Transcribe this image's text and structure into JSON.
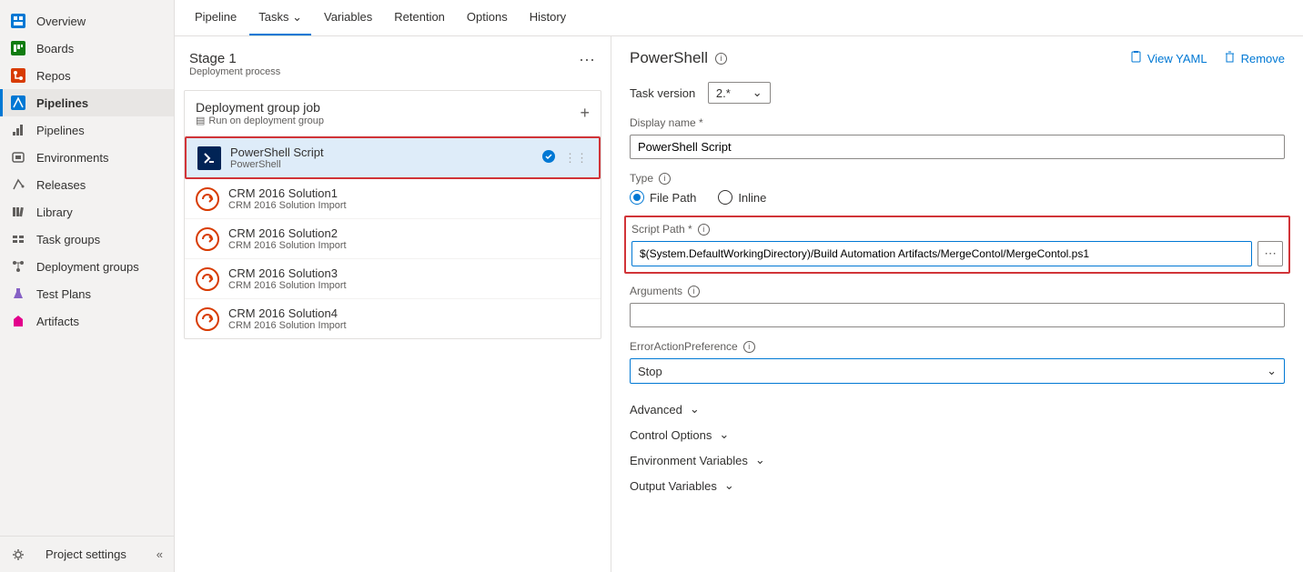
{
  "sidebar": {
    "items": [
      {
        "label": "Overview",
        "icon": "overview"
      },
      {
        "label": "Boards",
        "icon": "boards"
      },
      {
        "label": "Repos",
        "icon": "repos"
      },
      {
        "label": "Pipelines",
        "icon": "pipelines",
        "active": true
      },
      {
        "label": "Pipelines",
        "icon": "pipelines-sub",
        "sub": true
      },
      {
        "label": "Environments",
        "icon": "environments",
        "sub": true
      },
      {
        "label": "Releases",
        "icon": "releases",
        "sub": true
      },
      {
        "label": "Library",
        "icon": "library",
        "sub": true
      },
      {
        "label": "Task groups",
        "icon": "taskgroups",
        "sub": true
      },
      {
        "label": "Deployment groups",
        "icon": "deploymentgroups",
        "sub": true
      },
      {
        "label": "Test Plans",
        "icon": "testplans"
      },
      {
        "label": "Artifacts",
        "icon": "artifacts"
      }
    ],
    "footer": {
      "label": "Project settings"
    }
  },
  "tabs": [
    {
      "label": "Pipeline"
    },
    {
      "label": "Tasks",
      "active": true,
      "dropdown": true
    },
    {
      "label": "Variables"
    },
    {
      "label": "Retention"
    },
    {
      "label": "Options"
    },
    {
      "label": "History"
    }
  ],
  "stage": {
    "title": "Stage 1",
    "subtitle": "Deployment process",
    "job": {
      "title": "Deployment group job",
      "subtitle": "Run on deployment group"
    },
    "tasks": [
      {
        "title": "PowerShell Script",
        "sub": "PowerShell",
        "icon": "ps",
        "selected": true,
        "badge": true
      },
      {
        "title": "CRM 2016 Solution1",
        "sub": "CRM 2016 Solution Import",
        "icon": "crm"
      },
      {
        "title": "CRM 2016 Solution2",
        "sub": "CRM 2016 Solution Import",
        "icon": "crm"
      },
      {
        "title": "CRM 2016 Solution3",
        "sub": "CRM 2016 Solution Import",
        "icon": "crm"
      },
      {
        "title": "CRM 2016 Solution4",
        "sub": "CRM 2016 Solution Import",
        "icon": "crm"
      }
    ]
  },
  "details": {
    "title": "PowerShell",
    "actions": {
      "yaml": "View YAML",
      "remove": "Remove"
    },
    "task_version": {
      "label": "Task version",
      "value": "2.*"
    },
    "display_name": {
      "label": "Display name *",
      "value": "PowerShell Script"
    },
    "type": {
      "label": "Type",
      "options": [
        "File Path",
        "Inline"
      ],
      "selected": "File Path"
    },
    "script_path": {
      "label": "Script Path *",
      "value": "$(System.DefaultWorkingDirectory)/Build Automation Artifacts/MergeContol/MergeContol.ps1"
    },
    "arguments": {
      "label": "Arguments",
      "value": ""
    },
    "error_action": {
      "label": "ErrorActionPreference",
      "value": "Stop"
    },
    "sections": [
      "Advanced",
      "Control Options",
      "Environment Variables",
      "Output Variables"
    ]
  }
}
